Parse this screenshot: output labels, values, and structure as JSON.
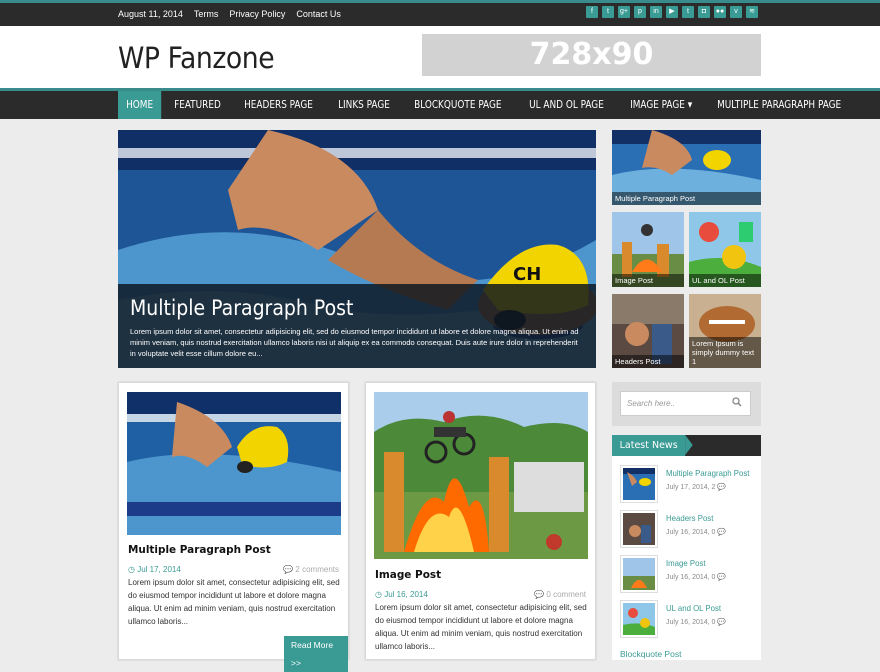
{
  "topbar": {
    "date": "August 11, 2014",
    "links": [
      "Terms",
      "Privacy Policy",
      "Contact Us"
    ],
    "social_icons": [
      "facebook-icon",
      "twitter-icon",
      "google-plus-icon",
      "pinterest-icon",
      "linkedin-icon",
      "youtube-icon",
      "tumblr-icon",
      "instagram-icon",
      "flickr-icon",
      "vimeo-icon",
      "rss-icon"
    ],
    "social_glyphs": [
      "f",
      "t",
      "g+",
      "p",
      "in",
      "▶",
      "t",
      "◘",
      "●●",
      "v",
      "≋"
    ]
  },
  "header": {
    "logo": "WP Fanzone",
    "banner": "728x90"
  },
  "nav": {
    "items": [
      "HOME",
      "FEATURED",
      "HEADERS PAGE",
      "LINKS PAGE",
      "BLOCKQUOTE PAGE",
      "UL AND OL PAGE",
      "IMAGE PAGE ▾",
      "MULTIPLE PARAGRAPH PAGE"
    ]
  },
  "hero": {
    "title": "Multiple Paragraph Post",
    "excerpt": "Lorem ipsum dolor sit amet, consectetur adipisicing elit, sed do eiusmod tempor incididunt ut labore et dolore magna aliqua. Ut enim ad minim veniam, quis nostrud exercitation ullamco laboris nisi ut aliquip ex ea commodo consequat. Duis aute irure dolor in reprehenderit in voluptate velit esse cillum dolore eu..."
  },
  "thumbs": [
    {
      "label": "Multiple Paragraph Post"
    },
    {
      "label": "Image Post"
    },
    {
      "label": "UL and OL Post"
    },
    {
      "label": "Headers Post"
    },
    {
      "label": "Lorem Ipsum is simply dummy text 1"
    }
  ],
  "posts": [
    {
      "title": "Multiple Paragraph Post",
      "date": "Jul 17, 2014",
      "comments": "2 comments",
      "excerpt": "Lorem ipsum dolor sit amet, consectetur adipisicing elit, sed do eiusmod tempor incididunt ut labore et dolore magna aliqua. Ut enim ad minim veniam, quis nostrud exercitation ullamco laboris...",
      "read_more": "Read More >>"
    },
    {
      "title": "Image Post",
      "date": "Jul 16, 2014",
      "comments": "0 comment",
      "excerpt": "Lorem ipsum dolor sit amet, consectetur adipisicing elit, sed do eiusmod tempor incididunt ut labore et dolore magna aliqua. Ut enim ad minim veniam, quis nostrud exercitation ullamco laboris..."
    }
  ],
  "sidebar": {
    "search_placeholder": "Search here..",
    "latest_title": "Latest News",
    "latest": [
      {
        "title": "Multiple Paragraph Post",
        "date": "July 17, 2014,",
        "count": "2"
      },
      {
        "title": "Headers Post",
        "date": "July 16, 2014,",
        "count": "0"
      },
      {
        "title": "Image Post",
        "date": "July 16, 2014,",
        "count": "0"
      },
      {
        "title": "UL and OL Post",
        "date": "July 16, 2014,",
        "count": "0"
      }
    ],
    "latest_last": "Blockquote Post"
  },
  "colors": {
    "accent": "#3a9a94",
    "dark": "#2b2b2b"
  }
}
